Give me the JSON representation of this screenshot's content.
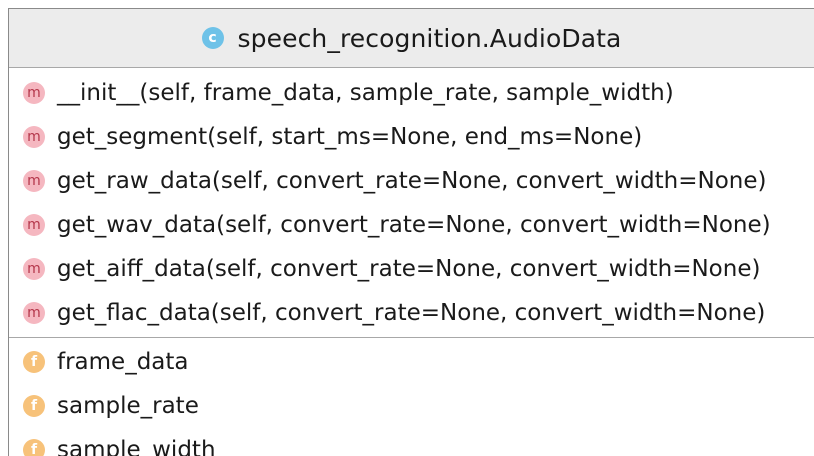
{
  "class": {
    "badge": "c",
    "name": "speech_recognition.AudioData",
    "badge_color": "#6ec2e8"
  },
  "methods": {
    "badge": "m",
    "badge_color": "#f5b7c0",
    "items": [
      "__init__(self, frame_data, sample_rate, sample_width)",
      "get_segment(self, start_ms=None, end_ms=None)",
      "get_raw_data(self, convert_rate=None, convert_width=None)",
      "get_wav_data(self, convert_rate=None, convert_width=None)",
      "get_aiff_data(self, convert_rate=None, convert_width=None)",
      "get_flac_data(self, convert_rate=None, convert_width=None)"
    ]
  },
  "fields": {
    "badge": "f",
    "badge_color": "#f7c27a",
    "items": [
      "frame_data",
      "sample_rate",
      "sample_width"
    ]
  }
}
